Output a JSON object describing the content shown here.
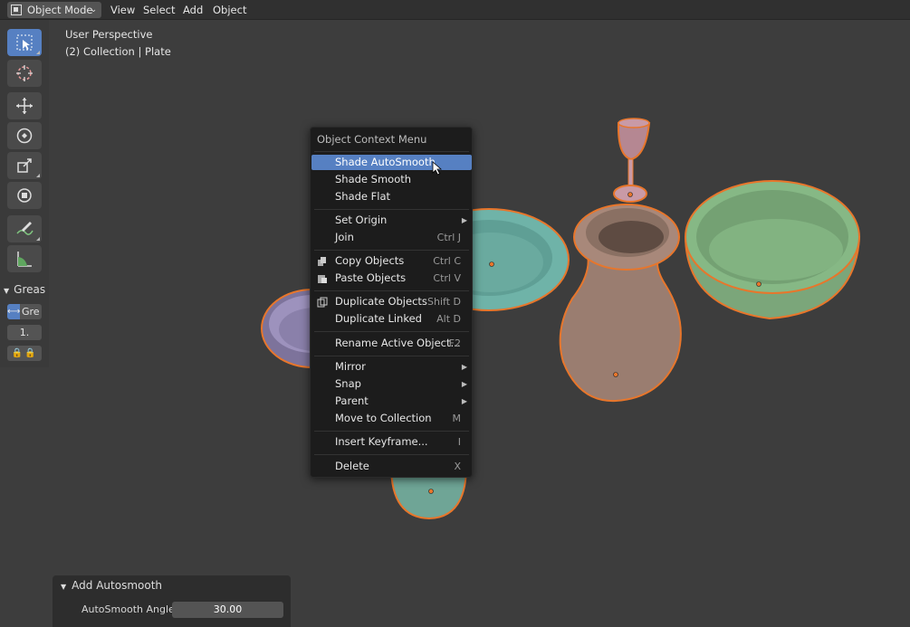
{
  "header": {
    "mode_label": "Object Mode",
    "menus": [
      "View",
      "Select",
      "Add",
      "Object"
    ]
  },
  "viewport": {
    "perspective": "User Perspective",
    "collection": "(2) Collection | Plate"
  },
  "toolbar": {
    "tools": [
      "select-box-icon",
      "cursor-icon",
      "move-icon",
      "rotate-icon",
      "scale-icon",
      "transform-icon",
      "annotate-icon",
      "measure-icon"
    ],
    "active_tool": "select-box-icon"
  },
  "grease_panel": {
    "title": "Greas",
    "layer_label": "Gre",
    "value": "1.",
    "locks": "🔒🔒"
  },
  "context_menu": {
    "title": "Object Context Menu",
    "items": [
      {
        "label": "Shade AutoSmooth",
        "shortcut": "",
        "highlighted": true
      },
      {
        "label": "Shade Smooth",
        "shortcut": ""
      },
      {
        "label": "Shade Flat",
        "shortcut": ""
      },
      {
        "label": "Set Origin",
        "shortcut": "",
        "submenu": true
      },
      {
        "label": "Join",
        "shortcut": "Ctrl J"
      },
      {
        "label": "Copy Objects",
        "shortcut": "Ctrl C",
        "icon": "copy-icon"
      },
      {
        "label": "Paste Objects",
        "shortcut": "Ctrl V",
        "icon": "paste-icon"
      },
      {
        "label": "Duplicate Objects",
        "shortcut": "Shift D",
        "icon": "duplicate-icon"
      },
      {
        "label": "Duplicate Linked",
        "shortcut": "Alt D"
      },
      {
        "label": "Rename Active Object...",
        "shortcut": "F2"
      },
      {
        "label": "Mirror",
        "shortcut": "",
        "submenu": true
      },
      {
        "label": "Snap",
        "shortcut": "",
        "submenu": true
      },
      {
        "label": "Parent",
        "shortcut": "",
        "submenu": true
      },
      {
        "label": "Move to Collection",
        "shortcut": "M"
      },
      {
        "label": "Insert Keyframe...",
        "shortcut": "I"
      },
      {
        "label": "Delete",
        "shortcut": "X"
      }
    ]
  },
  "redo_panel": {
    "title": "Add Autosmooth",
    "field_label": "AutoSmooth Angle",
    "field_value": "30.00"
  },
  "colors": {
    "accent": "#5680c2",
    "selection_outline": "#e8762b",
    "teal_material": "#6fb3a8",
    "green_material": "#86b885",
    "brown_material": "#a8887a",
    "pink_material": "#c99aa6",
    "purple_material": "#9d92bd"
  }
}
